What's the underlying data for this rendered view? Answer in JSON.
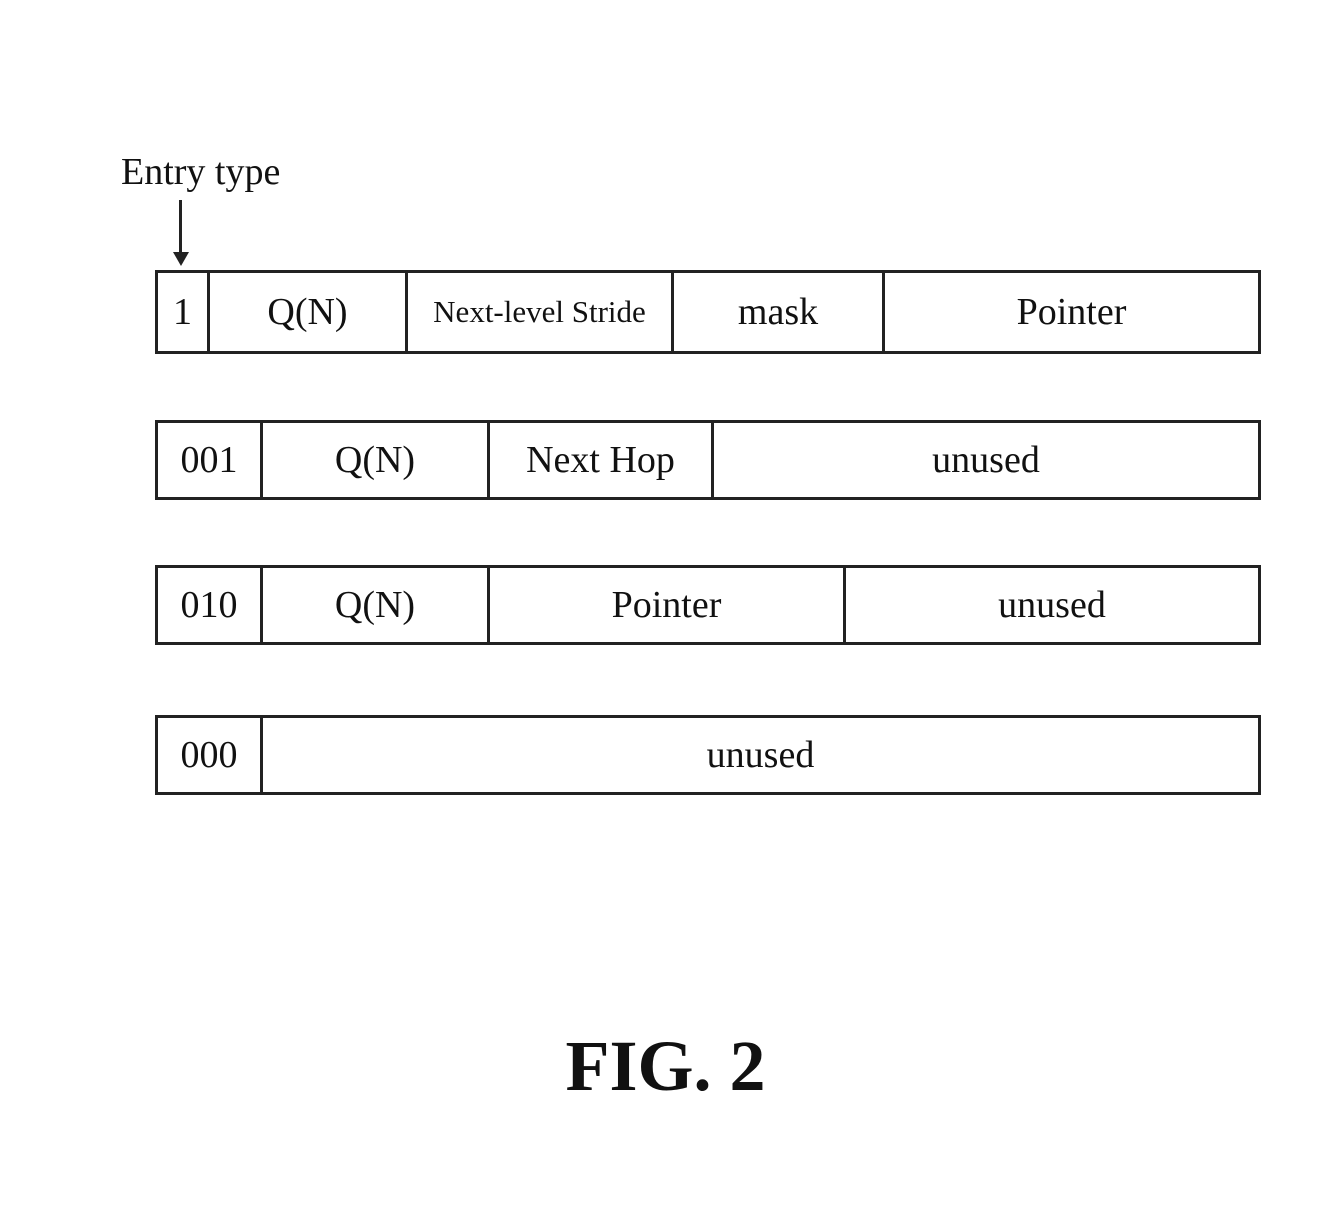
{
  "entry_type_label": "Entry type",
  "rows": [
    {
      "cells": [
        "1",
        "Q(N)",
        "Next-level Stride",
        "mask",
        "Pointer"
      ]
    },
    {
      "cells": [
        "001",
        "Q(N)",
        "Next Hop",
        "unused"
      ]
    },
    {
      "cells": [
        "010",
        "Q(N)",
        "Pointer",
        "unused"
      ]
    },
    {
      "cells": [
        "000",
        "unused"
      ]
    }
  ],
  "figure_label": "FIG. 2"
}
